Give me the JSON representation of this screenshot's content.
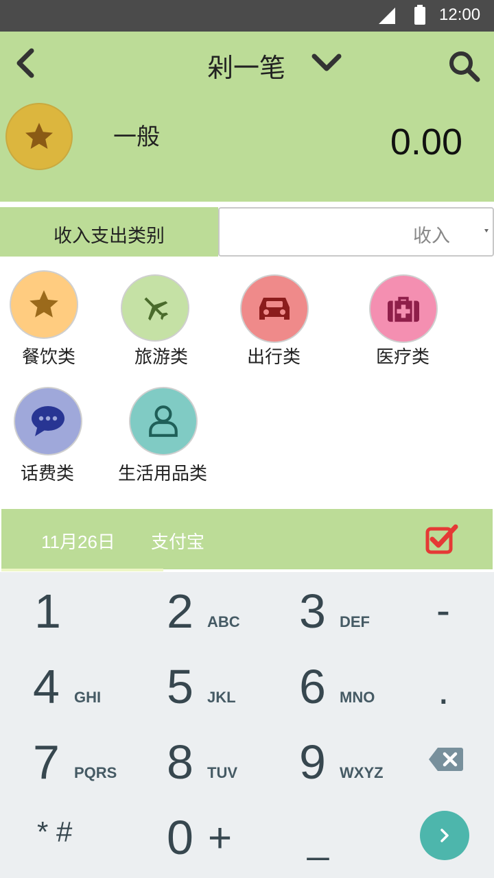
{
  "status_bar": {
    "time": "12:00"
  },
  "header": {
    "title": "剁一笔",
    "category_name": "一般",
    "amount": "0.00"
  },
  "type_row": {
    "label": "收入支出类别",
    "selected": "收入"
  },
  "categories": [
    {
      "label": "餐饮类",
      "icon": "star-icon",
      "color": "#ffcc80"
    },
    {
      "label": "旅游类",
      "icon": "airplane-icon",
      "color": "#c5e1a5"
    },
    {
      "label": "出行类",
      "icon": "car-icon",
      "color": "#ef8a8a"
    },
    {
      "label": "医疗类",
      "icon": "medical-kit-icon",
      "color": "#f48fb1"
    },
    {
      "label": "话费类",
      "icon": "chat-bubble-icon",
      "color": "#9fa8da"
    },
    {
      "label": "生活用品类",
      "icon": "person-icon",
      "color": "#80cbc4"
    }
  ],
  "info_bar": {
    "date": "11月26日",
    "account": "支付宝"
  },
  "keypad": {
    "keys": [
      {
        "digit": "1",
        "letters": ""
      },
      {
        "digit": "2",
        "letters": "ABC"
      },
      {
        "digit": "3",
        "letters": "DEF"
      },
      {
        "digit": "-",
        "letters": ""
      },
      {
        "digit": "4",
        "letters": "GHI"
      },
      {
        "digit": "5",
        "letters": "JKL"
      },
      {
        "digit": "6",
        "letters": "MNO"
      },
      {
        "digit": ".",
        "letters": ""
      },
      {
        "digit": "7",
        "letters": "PQRS"
      },
      {
        "digit": "8",
        "letters": "TUV"
      },
      {
        "digit": "9",
        "letters": "WXYZ"
      },
      {
        "digit": "* #",
        "letters": ""
      },
      {
        "digit": "0",
        "letters": "+"
      },
      {
        "digit": "_",
        "letters": ""
      }
    ]
  },
  "colors": {
    "header_green": "#bcdc97",
    "avatar_gold": "#dcb63e",
    "keypad_bg": "#eceff1",
    "next_teal": "#4db6ac",
    "confirm_red": "#e53935"
  }
}
